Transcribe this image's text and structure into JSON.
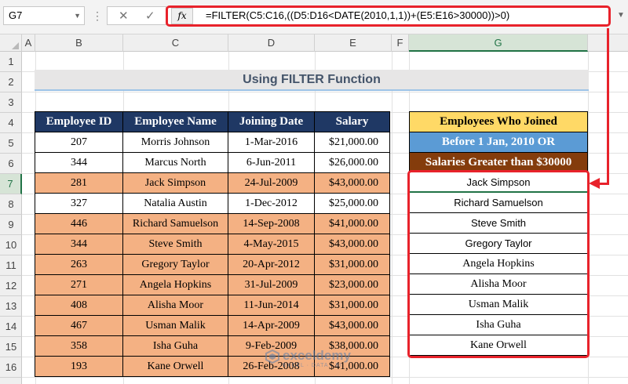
{
  "formula_bar": {
    "name_box": "G7",
    "fx_label": "fx",
    "formula": "=FILTER(C5:C16,((D5:D16<DATE(2010,1,1))+(E5:E16>30000))>0)"
  },
  "columns": [
    "A",
    "B",
    "C",
    "D",
    "E",
    "F",
    "G"
  ],
  "rows": [
    "1",
    "2",
    "3",
    "4",
    "5",
    "6",
    "7",
    "8",
    "9",
    "10",
    "11",
    "12",
    "13",
    "14",
    "15",
    "16"
  ],
  "active": {
    "column": "G",
    "row": "7"
  },
  "title": "Using FILTER Function",
  "table": {
    "headers": [
      "Employee ID",
      "Employee Name",
      "Joining Date",
      "Salary"
    ],
    "rows": [
      {
        "id": "207",
        "name": "Morris Johnson",
        "date": "1-Mar-2016",
        "salary": "$21,000.00",
        "highlight": false
      },
      {
        "id": "344",
        "name": "Marcus North",
        "date": "6-Jun-2011",
        "salary": "$26,000.00",
        "highlight": false
      },
      {
        "id": "281",
        "name": "Jack Simpson",
        "date": "24-Jul-2009",
        "salary": "$43,000.00",
        "highlight": true
      },
      {
        "id": "327",
        "name": "Natalia Austin",
        "date": "1-Dec-2012",
        "salary": "$25,000.00",
        "highlight": false
      },
      {
        "id": "446",
        "name": "Richard Samuelson",
        "date": "14-Sep-2008",
        "salary": "$41,000.00",
        "highlight": true
      },
      {
        "id": "344",
        "name": "Steve Smith",
        "date": "4-May-2015",
        "salary": "$43,000.00",
        "highlight": true
      },
      {
        "id": "263",
        "name": "Gregory Taylor",
        "date": "20-Apr-2012",
        "salary": "$31,000.00",
        "highlight": true
      },
      {
        "id": "271",
        "name": "Angela Hopkins",
        "date": "31-Jul-2009",
        "salary": "$23,000.00",
        "highlight": true
      },
      {
        "id": "408",
        "name": "Alisha Moor",
        "date": "11-Jun-2014",
        "salary": "$31,000.00",
        "highlight": true
      },
      {
        "id": "467",
        "name": "Usman Malik",
        "date": "14-Apr-2009",
        "salary": "$43,000.00",
        "highlight": true
      },
      {
        "id": "358",
        "name": "Isha Guha",
        "date": "9-Feb-2009",
        "salary": "$38,000.00",
        "highlight": true
      },
      {
        "id": "193",
        "name": "Kane Orwell",
        "date": "26-Feb-2008",
        "salary": "$41,000.00",
        "highlight": true
      }
    ]
  },
  "result": {
    "headers": [
      "Employees Who Joined",
      "Before 1 Jan, 2010 OR",
      "Salaries Greater than $30000"
    ],
    "names": [
      {
        "text": "Jack Simpson",
        "font": "sans"
      },
      {
        "text": "Richard Samuelson",
        "font": "sans"
      },
      {
        "text": "Steve Smith",
        "font": "sans"
      },
      {
        "text": "Gregory Taylor",
        "font": "sans"
      },
      {
        "text": "Angela Hopkins",
        "font": "serif"
      },
      {
        "text": "Alisha Moor",
        "font": "serif"
      },
      {
        "text": "Usman Malik",
        "font": "serif"
      },
      {
        "text": "Isha Guha",
        "font": "serif"
      },
      {
        "text": "Kane Orwell",
        "font": "serif"
      }
    ]
  },
  "colors": {
    "highlight_row": "#f4b183",
    "header_navy": "#1f3864",
    "result_yellow": "#ffd966",
    "result_blue": "#5b9bd5",
    "result_brown": "#843c0c",
    "annotation_red": "#e8222b",
    "excel_green": "#217346"
  },
  "icons": {
    "cancel": "✕",
    "enter": "✓",
    "dropdown": "▼",
    "dots": "⋮"
  },
  "watermark": {
    "name": "exceldemy",
    "tagline": "EXCEL · DATA · BI"
  }
}
